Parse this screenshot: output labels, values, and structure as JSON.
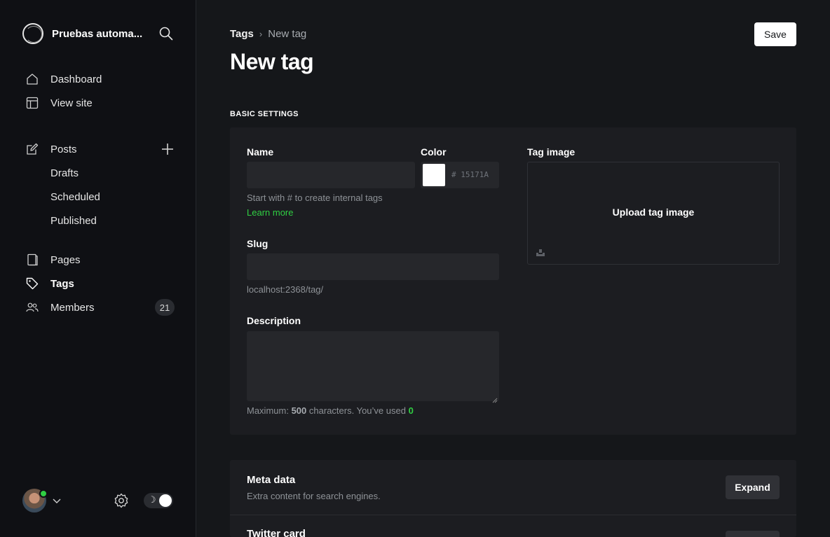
{
  "sidebar": {
    "brand_name": "Pruebas automa...",
    "nav": {
      "dashboard": "Dashboard",
      "view_site": "View site",
      "posts": "Posts",
      "drafts": "Drafts",
      "scheduled": "Scheduled",
      "published": "Published",
      "pages": "Pages",
      "tags": "Tags",
      "members": "Members",
      "members_count": "21"
    },
    "theme_moon": "☽"
  },
  "header": {
    "breadcrumb_parent": "Tags",
    "breadcrumb_sep": "›",
    "breadcrumb_current": "New tag",
    "title": "New tag",
    "save_label": "Save"
  },
  "basic_settings": {
    "section_label": "BASIC SETTINGS",
    "name_label": "Name",
    "name_value": "",
    "name_hint": "Start with # to create internal tags",
    "learn_more": "Learn more",
    "color_label": "Color",
    "color_value": "# 15171A",
    "slug_label": "Slug",
    "slug_value": "",
    "slug_hint": "localhost:2368/tag/",
    "description_label": "Description",
    "description_value": "",
    "desc_hint_prefix": "Maximum:",
    "desc_max": "500",
    "desc_hint_mid": "characters. You’ve used",
    "desc_used": "0",
    "tag_image_label": "Tag image",
    "upload_label": "Upload tag image"
  },
  "meta": {
    "title": "Meta data",
    "subtitle": "Extra content for search engines.",
    "expand_label": "Expand",
    "twitter_title": "Twitter card"
  },
  "colors": {
    "background": "#15171a",
    "sidebar": "#0f1014",
    "accent_green": "#30cf43"
  }
}
